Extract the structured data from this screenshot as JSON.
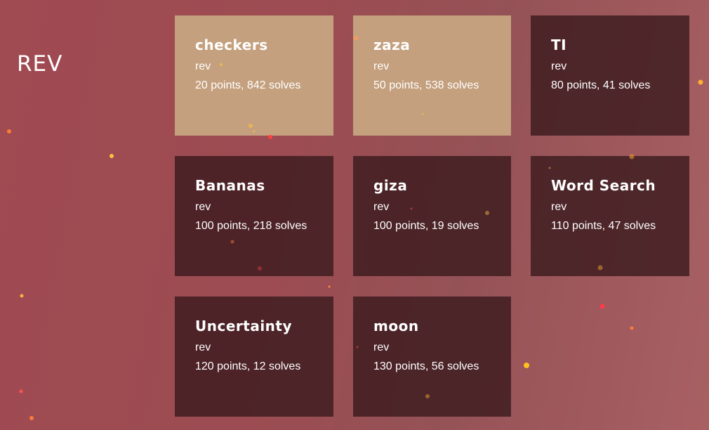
{
  "page": {
    "category_title": "REV"
  },
  "challenges": [
    {
      "name": "checkers",
      "category": "rev",
      "points": 20,
      "solves": 842,
      "stats": "20 points, 842 solves",
      "solved": true
    },
    {
      "name": "zaza",
      "category": "rev",
      "points": 50,
      "solves": 538,
      "stats": "50 points, 538 solves",
      "solved": true
    },
    {
      "name": "TI",
      "category": "rev",
      "points": 80,
      "solves": 41,
      "stats": "80 points, 41 solves",
      "solved": false
    },
    {
      "name": "Bananas",
      "category": "rev",
      "points": 100,
      "solves": 218,
      "stats": "100 points, 218 solves",
      "solved": false
    },
    {
      "name": "giza",
      "category": "rev",
      "points": 100,
      "solves": 19,
      "stats": "100 points, 19 solves",
      "solved": false
    },
    {
      "name": "Word Search",
      "category": "rev",
      "points": 110,
      "solves": 47,
      "stats": "110 points, 47 solves",
      "solved": false
    },
    {
      "name": "Uncertainty",
      "category": "rev",
      "points": 120,
      "solves": 12,
      "stats": "120 points, 12 solves",
      "solved": false
    },
    {
      "name": "moon",
      "category": "rev",
      "points": 130,
      "solves": 56,
      "stats": "130 points, 56 solves",
      "solved": false
    }
  ],
  "colors": {
    "background": "#a04a52",
    "card_unsolved": "#4a2529",
    "card_solved": "#c4a07e",
    "text": "#ffffff"
  }
}
